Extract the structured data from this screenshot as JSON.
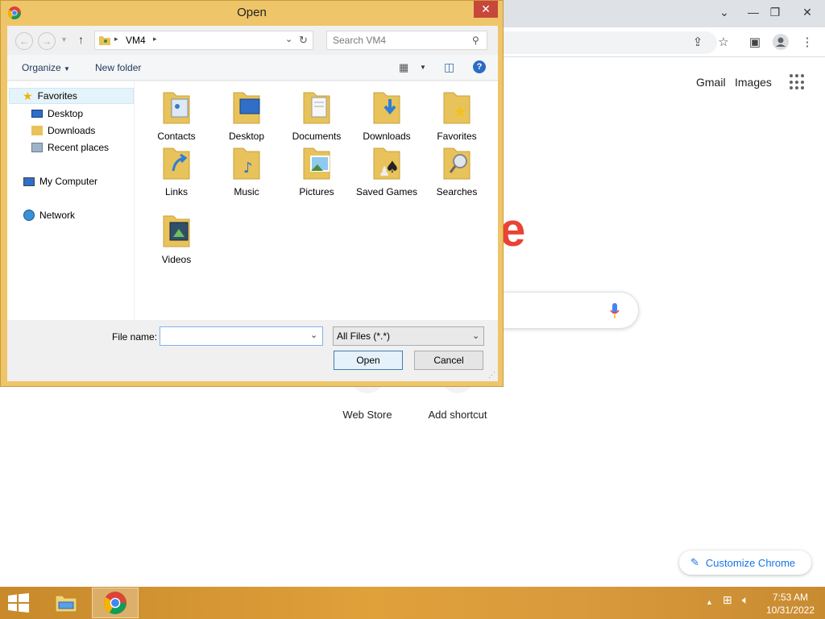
{
  "browser": {
    "header_links": {
      "gmail": "Gmail",
      "images": "Images"
    },
    "logo_fragment": "e",
    "shortcuts": [
      {
        "label": "Web Store"
      },
      {
        "label": "Add shortcut"
      }
    ],
    "customize_label": "Customize Chrome"
  },
  "dialog": {
    "title": "Open",
    "address": {
      "crumb": "VM4"
    },
    "search_placeholder": "Search VM4",
    "commands": {
      "organize": "Organize",
      "new_folder": "New folder"
    },
    "nav": {
      "favorites": "Favorites",
      "desktop": "Desktop",
      "downloads": "Downloads",
      "recent": "Recent places",
      "computer": "My Computer",
      "network": "Network"
    },
    "folders": [
      {
        "name": "Contacts",
        "icon": "contacts-folder-icon"
      },
      {
        "name": "Desktop",
        "icon": "desktop-folder-icon"
      },
      {
        "name": "Documents",
        "icon": "documents-folder-icon"
      },
      {
        "name": "Downloads",
        "icon": "downloads-folder-icon"
      },
      {
        "name": "Favorites",
        "icon": "favorites-folder-icon"
      },
      {
        "name": "Links",
        "icon": "links-folder-icon"
      },
      {
        "name": "Music",
        "icon": "music-folder-icon"
      },
      {
        "name": "Pictures",
        "icon": "pictures-folder-icon"
      },
      {
        "name": "Saved Games",
        "icon": "saved-games-folder-icon"
      },
      {
        "name": "Searches",
        "icon": "searches-folder-icon"
      },
      {
        "name": "Videos",
        "icon": "videos-folder-icon"
      }
    ],
    "file_name_label": "File name:",
    "file_name_value": "",
    "file_type": "All Files (*.*)",
    "open_button": "Open",
    "cancel_button": "Cancel"
  },
  "taskbar": {
    "time": "7:53 AM",
    "date": "10/31/2022"
  },
  "colors": {
    "taskbar": "#d89a3c",
    "dialog_frame": "#efc56a",
    "close_button": "#c7473a",
    "google_red": "#ea4335",
    "link_blue": "#1a73e8"
  }
}
